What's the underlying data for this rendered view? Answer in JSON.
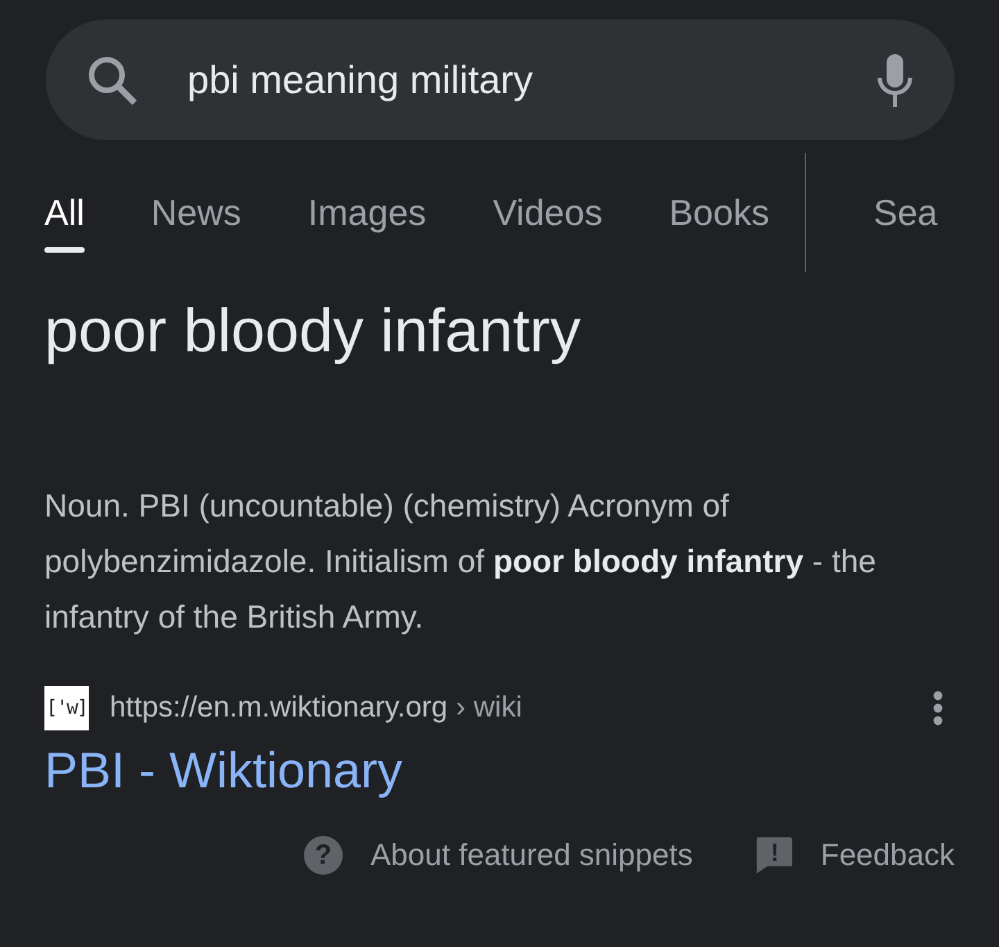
{
  "search": {
    "value": "pbi meaning military"
  },
  "tabs": [
    {
      "label": "All",
      "selected": true
    },
    {
      "label": "News",
      "selected": false
    },
    {
      "label": "Images",
      "selected": false
    },
    {
      "label": "Videos",
      "selected": false
    },
    {
      "label": "Books",
      "selected": false
    },
    {
      "label": "Sea",
      "selected": false
    }
  ],
  "featured_answer": "poor bloody infantry",
  "snippet": "Noun. PBI (uncountable) (chemistry) Acronym of polybenzimidazole. Initialism of **poor bloody infantry** - the infantry of the British Army.",
  "source": {
    "favicon": "['w]",
    "url": "https://en.m.wiktionary.org",
    "path": "› wiki",
    "title": "PBI - Wiktionary"
  },
  "footer": [
    {
      "icon": "?",
      "label": "About featured snippets"
    },
    {
      "icon": "!",
      "label": "Feedback"
    }
  ]
}
